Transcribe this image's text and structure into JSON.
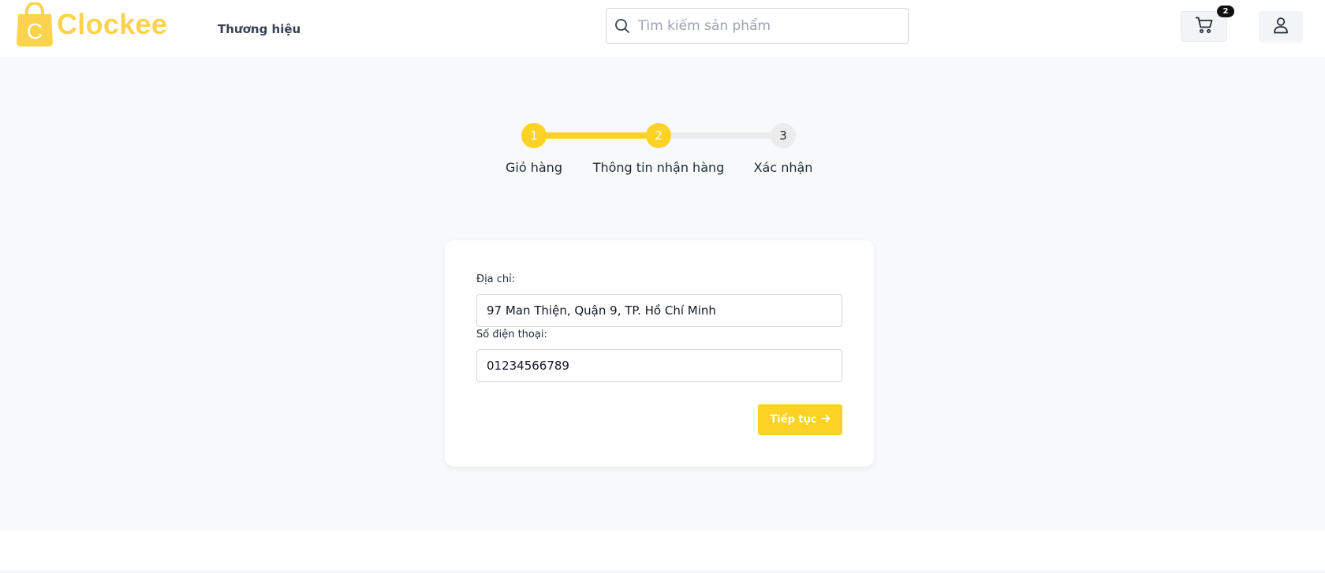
{
  "brand": {
    "name": "Clockee",
    "logo_letter": "C",
    "color": "#fcd34d"
  },
  "header": {
    "nav_brand": "Thương hiệu",
    "search": {
      "placeholder": "Tìm kiếm sản phẩm",
      "value": "",
      "icon": "search-icon"
    },
    "cart": {
      "icon": "cart-icon",
      "count": "2"
    },
    "user": {
      "icon": "user-icon"
    }
  },
  "stepper": {
    "progress": 0.5,
    "active_color": "#fcd225",
    "steps": [
      {
        "number": "1",
        "label": "Giỏ hàng",
        "state": "completed"
      },
      {
        "number": "2",
        "label": "Thông tin nhận hàng",
        "state": "active"
      },
      {
        "number": "3",
        "label": "Xác nhận",
        "state": "pending"
      }
    ]
  },
  "form": {
    "address": {
      "label": "Địa chỉ:",
      "value": "97 Man Thiện, Quận 9, TP. Hồ Chí Minh"
    },
    "phone": {
      "label": "Số điện thoại:",
      "value": "01234566789"
    },
    "submit": {
      "label": "Tiếp tục",
      "icon": "arrow-right-icon"
    }
  }
}
